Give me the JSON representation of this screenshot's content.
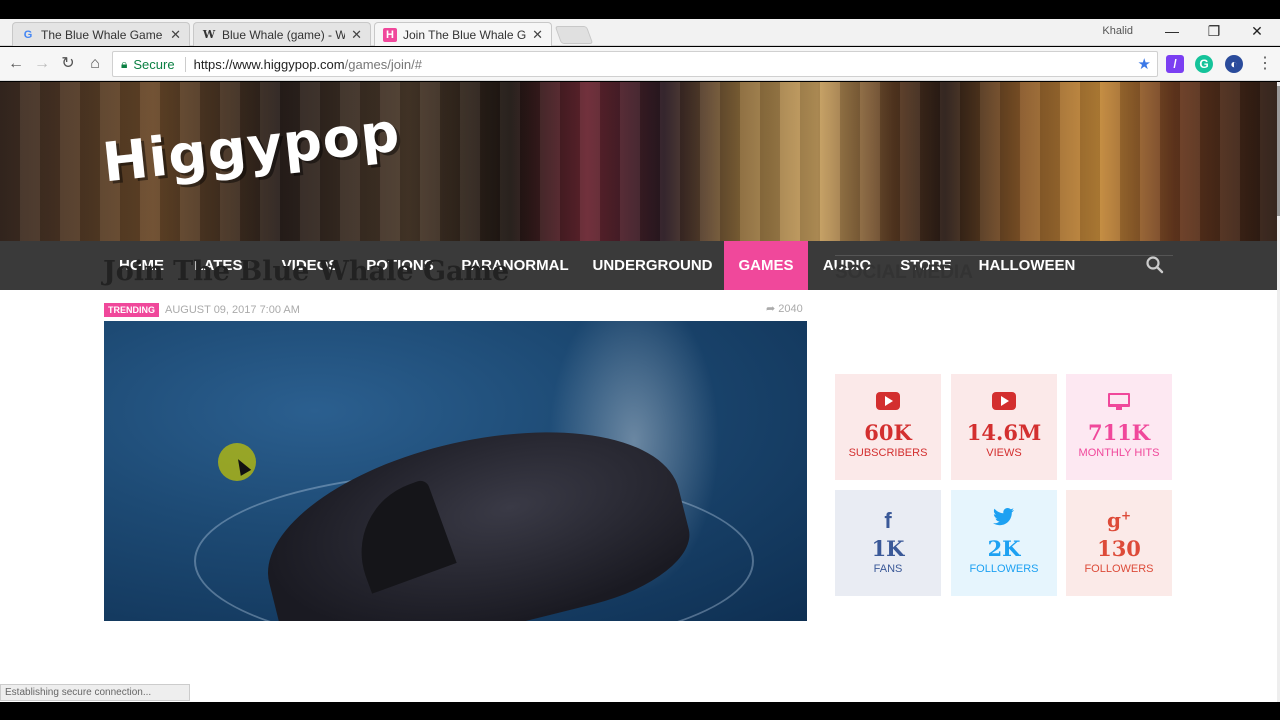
{
  "browser": {
    "tabs": [
      {
        "title": "The Blue Whale Game - ",
        "favicon": "G",
        "favicon_color": "#4285f4"
      },
      {
        "title": "Blue Whale (game) - Wi",
        "favicon": "W",
        "favicon_color": "#333333"
      },
      {
        "title": "Join The Blue Whale Gam",
        "favicon": "H",
        "favicon_color": "#f0489b"
      }
    ],
    "user": "Khalid",
    "secure_label": "Secure",
    "url_host": "https://www.higgypop.com",
    "url_path": "/games/join/#",
    "status_text": "Establishing secure connection..."
  },
  "site": {
    "logo": "Higgypop",
    "nav": [
      "HOME",
      "LATEST",
      "VIDEOS",
      "POTIONS",
      "PARANORMAL",
      "UNDERGROUND",
      "GAMES",
      "AUDIO",
      "STORE",
      "HALLOWEEN"
    ],
    "active_nav": "GAMES"
  },
  "article": {
    "title": "Join The Blue Whale Game",
    "badge": "TRENDING",
    "date": "AUGUST 09, 2017 7:00 AM",
    "shares": "2040"
  },
  "sidebar": {
    "title": "SOCIAL MEDIA",
    "stats": [
      {
        "icon": "youtube-icon",
        "value": "60K",
        "label": "SUBSCRIBERS",
        "color": "#d32f2f",
        "bg": "#fbe9e9"
      },
      {
        "icon": "youtube-icon",
        "value": "14.6M",
        "label": "VIEWS",
        "color": "#d32f2f",
        "bg": "#fbe9e9"
      },
      {
        "icon": "monitor-icon",
        "value": "711K",
        "label": "MONTHLY HITS",
        "color": "#f0489b",
        "bg": "#fde8f2"
      },
      {
        "icon": "facebook-icon",
        "value": "1K",
        "label": "FANS",
        "color": "#3b5998",
        "bg": "#e9ecf3"
      },
      {
        "icon": "twitter-icon",
        "value": "2K",
        "label": "FOLLOWERS",
        "color": "#1da1f2",
        "bg": "#e6f5fd"
      },
      {
        "icon": "googleplus-icon",
        "value": "130",
        "label": "FOLLOWERS",
        "color": "#dd4b39",
        "bg": "#fbeae8"
      }
    ]
  }
}
